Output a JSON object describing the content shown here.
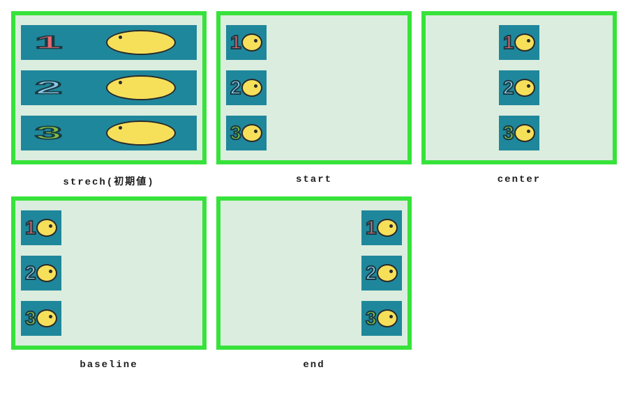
{
  "items": {
    "one": "1",
    "two": "2",
    "three": "3"
  },
  "panels": [
    {
      "key": "stretch",
      "label": "strech(初期値)"
    },
    {
      "key": "start",
      "label": "start"
    },
    {
      "key": "center",
      "label": "center"
    },
    {
      "key": "baseline",
      "label": "baseline"
    },
    {
      "key": "end",
      "label": "end"
    }
  ],
  "colors": {
    "border": "#37e23b",
    "panel_bg": "#dbeddf",
    "item_bg": "#1f879b",
    "bird": "#f6e05a",
    "num1": "#e76a6f",
    "num2": "#8bc8e6",
    "num3": "#7fbf3f"
  }
}
